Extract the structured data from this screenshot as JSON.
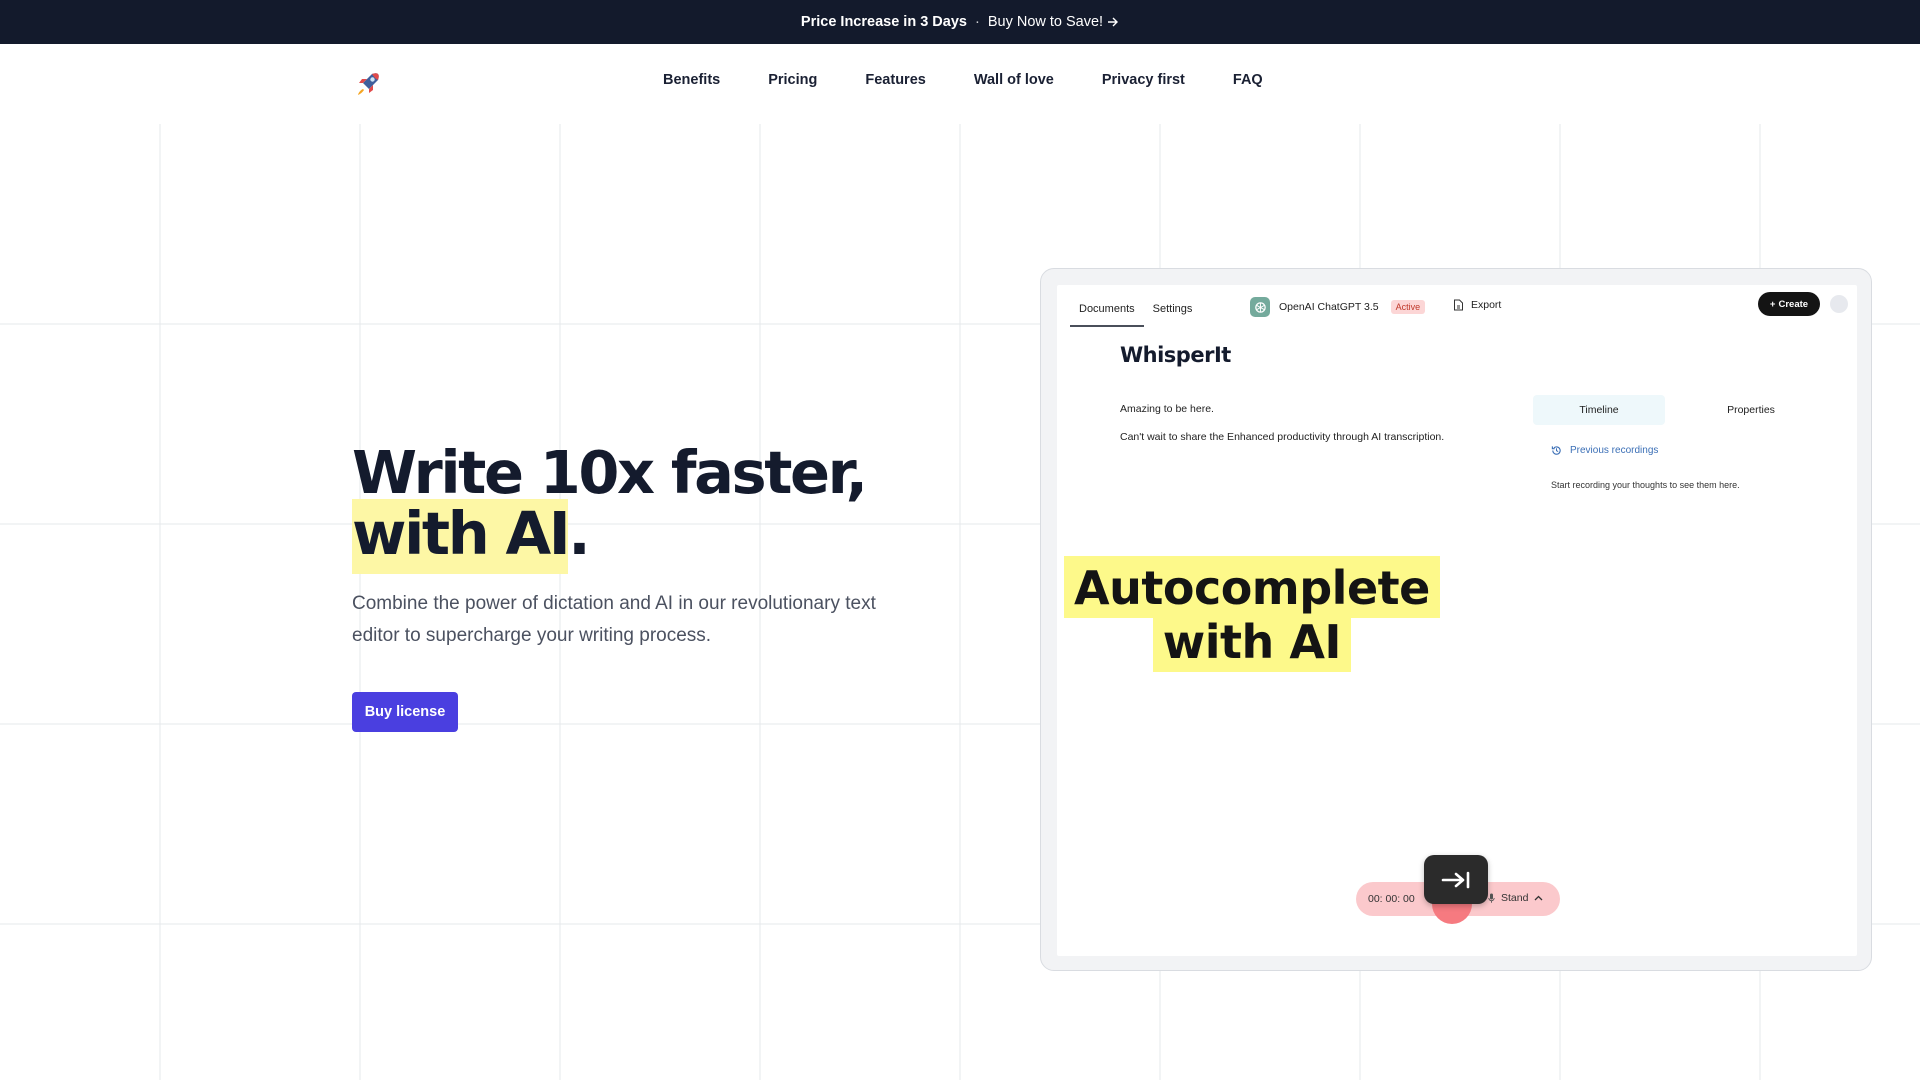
{
  "announcement": {
    "headline": "Price Increase in 3 Days",
    "separator": "·",
    "cta": "Buy Now to Save!"
  },
  "nav": {
    "items": [
      "Benefits",
      "Pricing",
      "Features",
      "Wall of love",
      "Privacy first",
      "FAQ"
    ]
  },
  "hero": {
    "title_line1": "Write 10x faster,",
    "title_highlight": "with AI",
    "title_end": ".",
    "subtitle": "Combine the power of dictation and AI in our revolutionary text editor to supercharge your writing process.",
    "cta": "Buy license"
  },
  "app": {
    "tabs": [
      "Documents",
      "Settings"
    ],
    "model": "OpenAI ChatGPT 3.5",
    "model_status": "Active",
    "export": "Export",
    "create": "Create",
    "doc_title": "WhisperIt",
    "lines": [
      "Amazing to be here.",
      "Can't wait to share the Enhanced productivity through AI transcription."
    ],
    "side_tabs": [
      "Timeline",
      "Properties"
    ],
    "previous_recordings": "Previous recordings",
    "empty_hint": "Start recording your thoughts to see them here.",
    "recorder": {
      "time": "00: 00: 00",
      "mode": "Stand"
    }
  },
  "overlay": {
    "line1": "Autocomplete",
    "line2": "with AI"
  },
  "colors": {
    "announcement_bg": "#131a2c",
    "accent": "#4a3fe0",
    "highlight": "#fdf7a5",
    "record_pill": "#fbc9cc"
  }
}
